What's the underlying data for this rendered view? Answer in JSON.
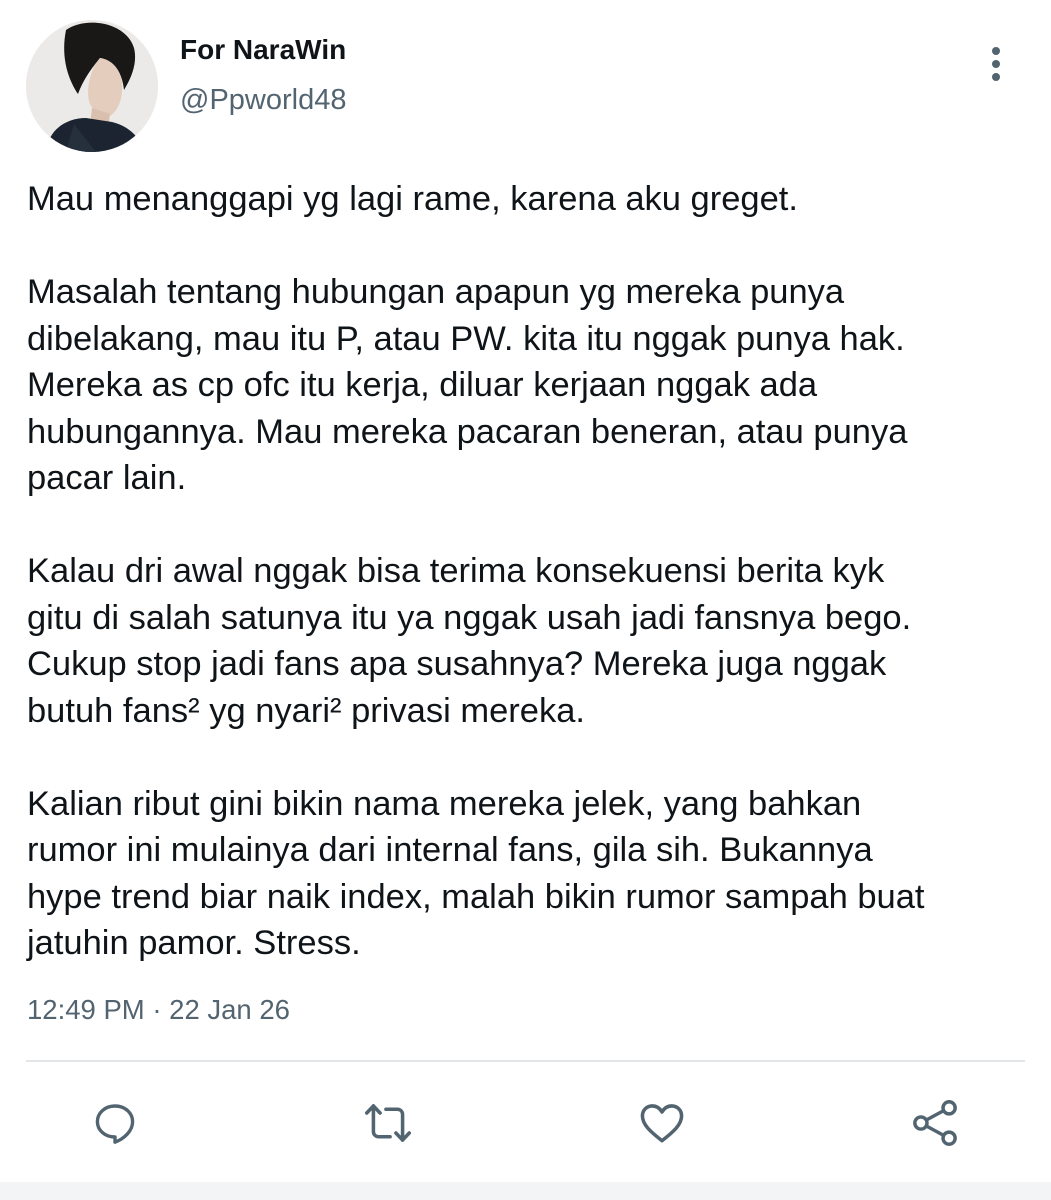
{
  "author": {
    "display_name": "For NaraWin",
    "handle": "@Ppworld48",
    "avatar_icon": "profile-photo"
  },
  "tweet": {
    "paragraphs": [
      [
        "Mau menanggapi yg lagi rame, karena aku greget."
      ],
      [
        "Masalah tentang hubungan apapun yg mereka punya",
        "dibelakang, mau itu P, atau PW. kita itu nggak punya hak.",
        "Mereka as cp ofc itu kerja, diluar kerjaan nggak ada",
        "hubungannya. Mau mereka pacaran beneran, atau punya",
        "pacar lain."
      ],
      [
        "Kalau dri awal nggak bisa terima konsekuensi berita kyk",
        "gitu di salah satunya itu ya nggak usah jadi fansnya bego.",
        "Cukup stop jadi fans apa susahnya? Mereka juga nggak",
        "butuh fans² yg nyari² privasi mereka."
      ],
      [
        "Kalian ribut gini bikin nama mereka jelek, yang bahkan",
        "rumor ini mulainya dari internal fans, gila sih. Bukannya",
        "hype trend biar naik index, malah bikin rumor sampah buat",
        "jatuhin pamor. Stress."
      ]
    ],
    "timestamp": "12:49 PM · 22 Jan 26"
  },
  "actions": [
    {
      "name": "reply-button",
      "icon": "reply-icon"
    },
    {
      "name": "retweet-button",
      "icon": "retweet-icon"
    },
    {
      "name": "like-button",
      "icon": "heart-icon"
    },
    {
      "name": "share-button",
      "icon": "share-icon"
    }
  ],
  "colors": {
    "text_primary": "#0f1419",
    "text_secondary": "#536471",
    "icon": "#536471",
    "divider": "#e3e6e8"
  }
}
